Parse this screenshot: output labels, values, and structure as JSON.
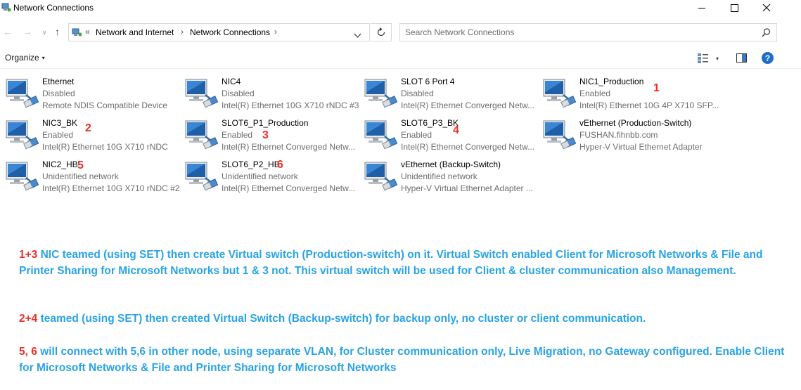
{
  "window": {
    "title": "Network Connections",
    "minimize_glyph": "—",
    "maximize_glyph": "☐",
    "close_glyph": "✕"
  },
  "navigation": {
    "back_glyph": "←",
    "forward_glyph": "→",
    "recent_glyph": "∨",
    "up_glyph": "↑"
  },
  "address": {
    "overflow": "«",
    "crumbs": [
      "Network and Internet",
      "Network Connections"
    ],
    "separator": "›",
    "dropdown_glyph": "∨"
  },
  "search": {
    "placeholder": "Search Network Connections"
  },
  "toolbar": {
    "organize_label": "Organize",
    "organize_caret": "▾",
    "views_caret": "▾",
    "help_label": "?"
  },
  "connections": [
    {
      "name": "Ethernet",
      "status": "Disabled",
      "device": "Remote NDIS Compatible Device",
      "marker": ""
    },
    {
      "name": "NIC4",
      "status": "Disabled",
      "device": "Intel(R) Ethernet 10G X710 rNDC #3",
      "marker": ""
    },
    {
      "name": "SLOT 6 Port 4",
      "status": "Disabled",
      "device": "Intel(R) Ethernet Converged Netw...",
      "marker": ""
    },
    {
      "name": "NIC1_Production",
      "status": "Enabled",
      "device": "Intel(R) Ethernet 10G 4P X710 SFP...",
      "marker": "1"
    },
    {
      "name": "NIC3_BK",
      "status": "Enabled",
      "device": "Intel(R) Ethernet 10G X710 rNDC",
      "marker": "2"
    },
    {
      "name": "SLOT6_P1_Production",
      "status": "Enabled",
      "device": "Intel(R) Ethernet Converged Netw...",
      "marker": "3"
    },
    {
      "name": "SLOT6_P3_BK",
      "status": "Enabled",
      "device": "Intel(R) Ethernet Converged Netw...",
      "marker": "4"
    },
    {
      "name": "vEthernet (Production-Switch)",
      "status": "FUSHAN.fihnbb.com",
      "device": "Hyper-V Virtual Ethernet Adapter",
      "marker": ""
    },
    {
      "name": "NIC2_HB",
      "status": "Unidentified network",
      "device": "Intel(R) Ethernet 10G X710 rNDC #2",
      "marker": "5"
    },
    {
      "name": "SLOT6_P2_HB",
      "status": "Unidentified network",
      "device": "Intel(R) Ethernet Converged Netw...",
      "marker": "6"
    },
    {
      "name": "vEthernet (Backup-Switch)",
      "status": "Unidentified network",
      "device": "Hyper-V Virtual Ethernet Adapter ...",
      "marker": ""
    }
  ],
  "notes": [
    {
      "highlight": "1+3",
      "text": " NIC teamed (using SET) then create Virtual switch (Production-switch) on it. Virtual Switch enabled Client for Microsoft Networks & File and Printer Sharing for Microsoft Networks but 1 & 3 not. This virtual switch will be used for Client & cluster communication also Management."
    },
    {
      "highlight": "2+4",
      "text": " teamed (using SET) then created Virtual Switch  (Backup-switch) for backup only, no cluster or client communication."
    },
    {
      "highlight": "5, 6",
      "text": " will connect with 5,6 in other node, using separate VLAN, for Cluster communication only, Live Migration, no Gateway configured. Enable Client for Microsoft Networks & File and Printer Sharing for Microsoft Networks"
    }
  ],
  "colors": {
    "note_text": "#29a3e6",
    "note_highlight": "#e8312a",
    "marker": "#e8312a",
    "help_button": "#1f6fc8"
  }
}
